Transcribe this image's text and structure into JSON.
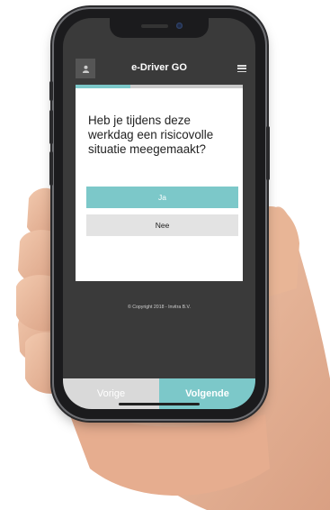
{
  "app": {
    "title": "e-Driver GO",
    "user_icon": "user-icon",
    "menu_icon": "hamburger-menu-icon"
  },
  "progress": {
    "fraction": 0.33,
    "color": "#7cc8c9"
  },
  "question": {
    "text": "Heb je tijdens deze werkdag een risicovolle situatie meegemaakt?"
  },
  "answers": {
    "yes_label": "Ja",
    "no_label": "Nee"
  },
  "footer": {
    "copyright": "© Copyright 2018 - Invitra B.V."
  },
  "nav": {
    "prev_label": "Vorige",
    "next_label": "Volgende"
  },
  "colors": {
    "accent": "#7cc8c9",
    "background": "#3a3a3a",
    "card": "#ffffff"
  }
}
